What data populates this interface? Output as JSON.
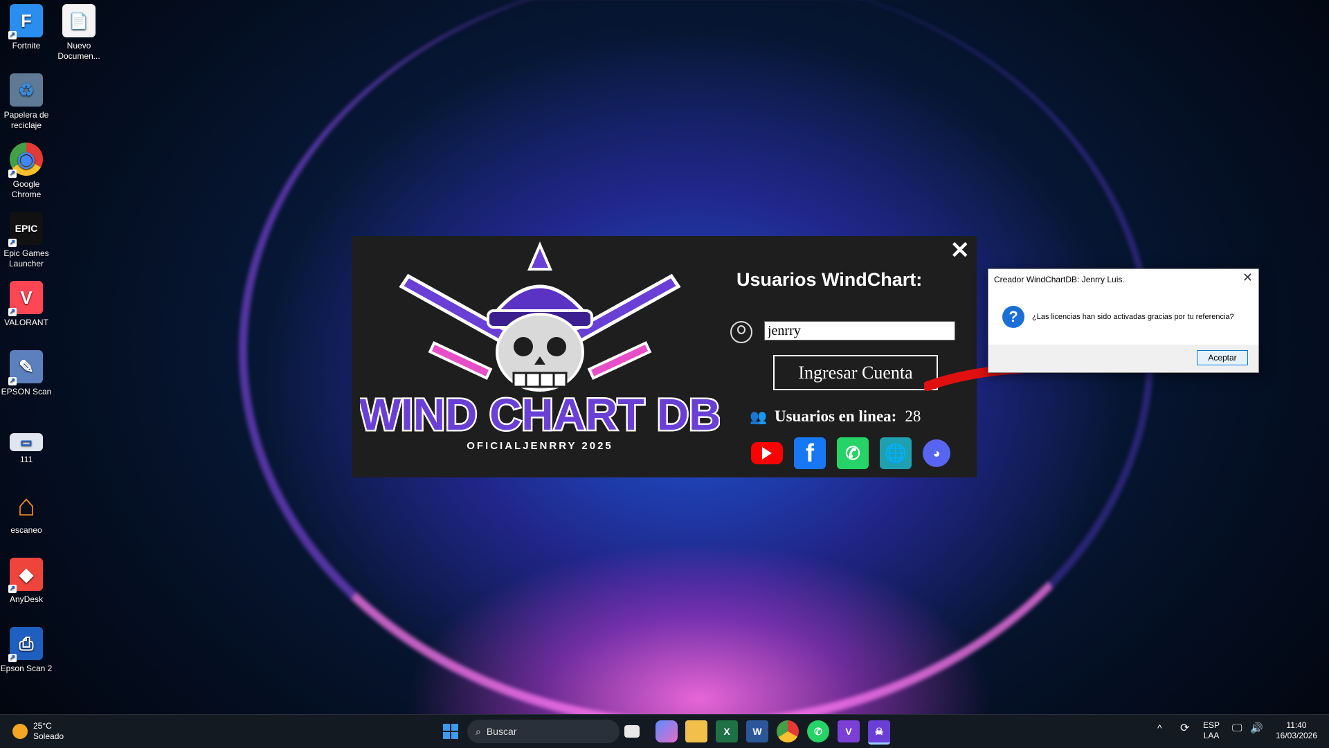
{
  "desktop": {
    "icons": [
      {
        "label": "Fortnite",
        "glyph": "F",
        "color": "#2a8df0"
      },
      {
        "label": "Nuevo Documen...",
        "glyph": "📄",
        "color": "#f4f4f4"
      },
      {
        "label": "Papelera de reciclaje",
        "glyph": "♻",
        "color": "#9cc4e8"
      },
      {
        "label": "Google Chrome",
        "glyph": "◉",
        "color": "#e53935"
      },
      {
        "label": "Epic Games Launcher",
        "glyph": "EPIC",
        "color": "#111111"
      },
      {
        "label": "VALORANT",
        "glyph": "V",
        "color": "#ff4655"
      },
      {
        "label": "EPSON Scan",
        "glyph": "✎",
        "color": "#5c7fbd"
      },
      {
        "label": "111",
        "glyph": "▭",
        "color": "#dfe6ef"
      },
      {
        "label": "escaneo",
        "glyph": "⌂",
        "color": "#f08a24"
      },
      {
        "label": "AnyDesk",
        "glyph": "◆",
        "color": "#ef443b"
      },
      {
        "label": "Epson Scan 2",
        "glyph": "⎙",
        "color": "#1f5fbf"
      }
    ]
  },
  "login": {
    "close": "✕",
    "title": "Usuarios WindChart:",
    "username_value": "jenrry",
    "login_button": "Ingresar Cuenta",
    "online_label": "Usuarios en linea:",
    "online_count": "28",
    "logo_title": "WIND CHART DB",
    "logo_subtitle": "OFICIALJENRRY 2025",
    "social": {
      "youtube_color": "#ff0000",
      "facebook_color": "#1877f2",
      "whatsapp_color": "#25d366",
      "web_color": "#1fa0b0",
      "discord_color": "#5865f2"
    }
  },
  "dialog": {
    "title": "Creador WindChartDB: Jenrry Luis.",
    "close": "✕",
    "icon": "?",
    "message": "¿Las licencias han sido activadas gracias por tu referencia?",
    "ok_button": "Aceptar"
  },
  "taskbar": {
    "weather_temp": "25°C",
    "weather_desc": "Soleado",
    "search_placeholder": "Buscar",
    "lang_top": "ESP",
    "lang_bottom": "LAA",
    "time": "11:40",
    "date": "16/03/2026",
    "colors": {
      "accent": "#0078d4"
    }
  }
}
